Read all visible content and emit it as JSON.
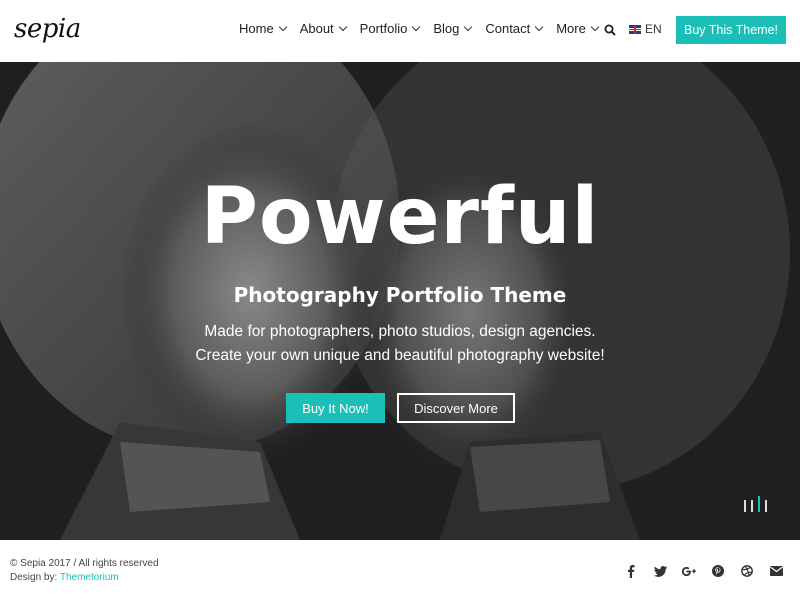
{
  "header": {
    "logo_text": "sepia",
    "nav": [
      {
        "label": "Home"
      },
      {
        "label": "About"
      },
      {
        "label": "Portfolio"
      },
      {
        "label": "Blog"
      },
      {
        "label": "Contact"
      },
      {
        "label": "More"
      }
    ],
    "language": "EN",
    "buy_button": "Buy This Theme!"
  },
  "hero": {
    "title": "Powerful",
    "subtitle": "Photography Portfolio Theme",
    "desc_line1": "Made for photographers, photo studios, design agencies.",
    "desc_line2": "Create your own unique and beautiful photography website!",
    "primary_button": "Buy It Now!",
    "secondary_button": "Discover More",
    "slides_count": 4,
    "active_slide": 3
  },
  "footer": {
    "copyright": "© Sepia 2017  /  All rights reserved",
    "design_by_label": "Design by: ",
    "design_by_link": "Themetorium",
    "social": [
      "facebook-icon",
      "twitter-icon",
      "google-plus-icon",
      "pinterest-icon",
      "dribbble-icon",
      "email-icon"
    ]
  },
  "colors": {
    "accent": "#1bbfb7",
    "text": "#222222",
    "hero_bg": "#2a2a2a"
  }
}
